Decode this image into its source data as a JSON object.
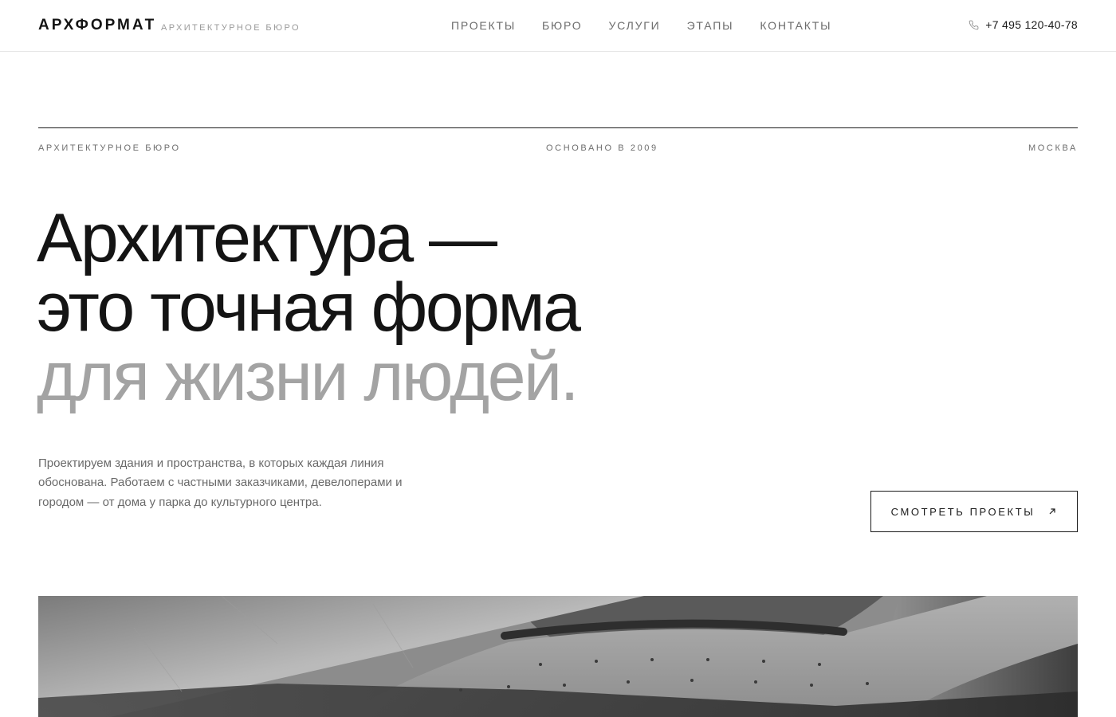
{
  "header": {
    "logo": "АРХФОРМАТ",
    "logo_sub": "АРХИТЕКТУРНОЕ БЮРО",
    "nav": [
      {
        "label": "ПРОЕКТЫ"
      },
      {
        "label": "БЮРО"
      },
      {
        "label": "УСЛУГИ"
      },
      {
        "label": "ЭТАПЫ"
      },
      {
        "label": "КОНТАКТЫ"
      }
    ],
    "phone": "+7 495 120-40-78",
    "phone_icon": "phone-icon"
  },
  "meta": {
    "left": "АРХИТЕКТУРНОЕ БЮРО",
    "center": "ОСНОВАНО В 2009",
    "right": "МОСКВА"
  },
  "hero": {
    "headline_line1": "Архитектура —",
    "headline_line2": "это точная форма",
    "headline_line3": "для жизни людей.",
    "description": "Проектируем здания и пространства, в которых каждая линия обоснована. Работаем с частными заказчиками, девелоперами и городом — от дома у парка до культурного центра.",
    "cta_label": "СМОТРЕТЬ ПРОЕКТЫ",
    "cta_icon": "arrow-up-right-icon",
    "image": "concrete-architecture-photo"
  },
  "colors": {
    "text": "#141414",
    "muted_headline": "#a3a3a3",
    "secondary_text": "#6a6a6a",
    "border": "#1a1a1a"
  }
}
